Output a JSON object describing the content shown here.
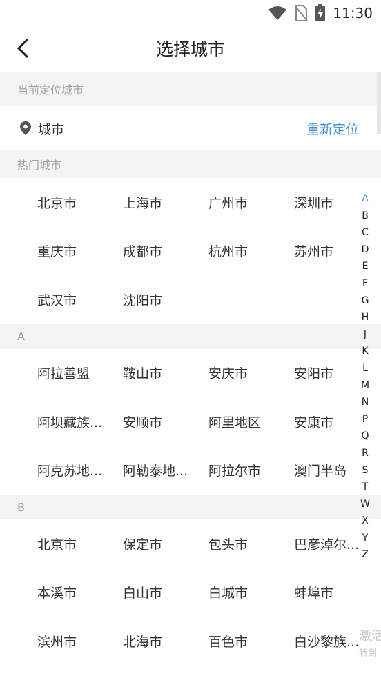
{
  "status_bar": {
    "time": "11:30",
    "icons": [
      "wifi-icon",
      "no-sim-icon",
      "battery-charging-icon"
    ]
  },
  "nav": {
    "title": "选择城市",
    "back_icon": "chevron-left-icon"
  },
  "current_location": {
    "header": "当前定位城市",
    "city": "城市",
    "relocate_label": "重新定位",
    "icon": "location-pin-icon"
  },
  "hot_cities": {
    "header": "热门城市",
    "rows": [
      [
        "北京市",
        "上海市",
        "广州市",
        "深圳市"
      ],
      [
        "重庆市",
        "成都市",
        "杭州市",
        "苏州市"
      ],
      [
        "武汉市",
        "沈阳市"
      ]
    ]
  },
  "groups": [
    {
      "letter": "A",
      "rows": [
        [
          "阿拉善盟",
          "鞍山市",
          "安庆市",
          "安阳市"
        ],
        [
          "阿坝藏族...",
          "安顺市",
          "阿里地区",
          "安康市"
        ],
        [
          "阿克苏地...",
          "阿勒泰地...",
          "阿拉尔市",
          "澳门半岛"
        ]
      ]
    },
    {
      "letter": "B",
      "rows": [
        [
          "北京市",
          "保定市",
          "包头市",
          "巴彦淖尔..."
        ],
        [
          "本溪市",
          "白山市",
          "白城市",
          "蚌埠市"
        ],
        [
          "滨州市",
          "北海市",
          "百色市",
          "白沙黎族..."
        ]
      ]
    }
  ],
  "index_letters": [
    "A",
    "B",
    "C",
    "D",
    "E",
    "F",
    "G",
    "H",
    "J",
    "K",
    "L",
    "M",
    "N",
    "P",
    "Q",
    "R",
    "S",
    "T",
    "W",
    "X",
    "Y",
    "Z"
  ],
  "active_letter": "A",
  "watermark": {
    "line1": "激活",
    "line2": "转到"
  },
  "colors": {
    "accent": "#3f8fd2",
    "section_bg": "#f4f4f5",
    "muted_text": "#a0a0a0"
  }
}
